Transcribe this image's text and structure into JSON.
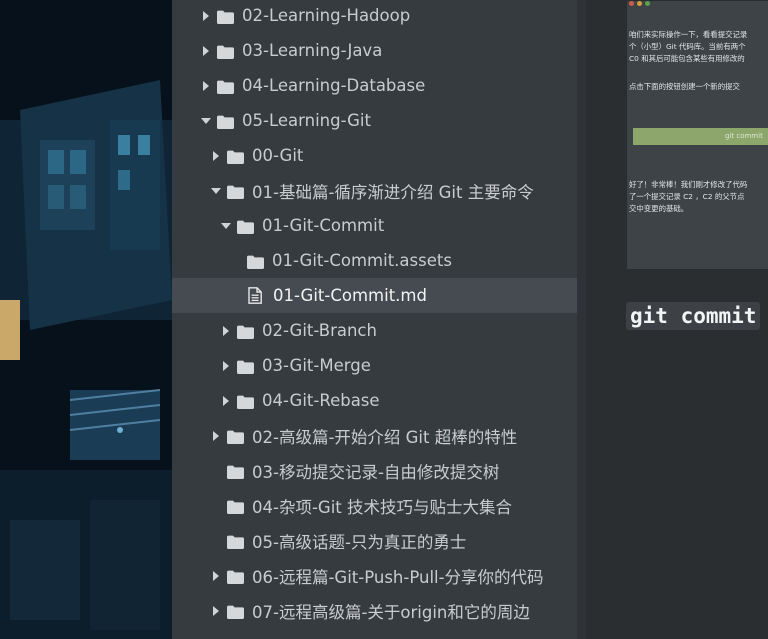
{
  "tree": [
    {
      "label": "02-Learning-Hadoop",
      "indent": 0,
      "type": "folder",
      "expanded": false
    },
    {
      "label": "03-Learning-Java",
      "indent": 0,
      "type": "folder",
      "expanded": false
    },
    {
      "label": "04-Learning-Database",
      "indent": 0,
      "type": "folder",
      "expanded": false
    },
    {
      "label": "05-Learning-Git",
      "indent": 0,
      "type": "folder",
      "expanded": true
    },
    {
      "label": "00-Git",
      "indent": 1,
      "type": "folder",
      "expanded": false
    },
    {
      "label": "01-基础篇-循序渐进介绍 Git 主要命令",
      "indent": 1,
      "type": "folder",
      "expanded": true
    },
    {
      "label": "01-Git-Commit",
      "indent": 2,
      "type": "folder",
      "expanded": true
    },
    {
      "label": "01-Git-Commit.assets",
      "indent": 3,
      "type": "folder",
      "expanded": null
    },
    {
      "label": "01-Git-Commit.md",
      "indent": 3,
      "type": "file",
      "selected": true
    },
    {
      "label": "02-Git-Branch",
      "indent": 2,
      "type": "folder",
      "expanded": false
    },
    {
      "label": "03-Git-Merge",
      "indent": 2,
      "type": "folder",
      "expanded": false
    },
    {
      "label": "04-Git-Rebase",
      "indent": 2,
      "type": "folder",
      "expanded": false
    },
    {
      "label": "02-高级篇-开始介绍 Git 超棒的特性",
      "indent": 1,
      "type": "folder",
      "expanded": false
    },
    {
      "label": "03-移动提交记录-自由修改提交树",
      "indent": 1,
      "type": "folder",
      "expanded": null
    },
    {
      "label": "04-杂项-Git 技术技巧与贴士大集合",
      "indent": 1,
      "type": "folder",
      "expanded": null
    },
    {
      "label": "05-高级话题-只为真正的勇士",
      "indent": 1,
      "type": "folder",
      "expanded": null
    },
    {
      "label": "06-远程篇-Git-Push-Pull-分享你的代码",
      "indent": 1,
      "type": "folder",
      "expanded": false
    },
    {
      "label": "07-远程高级篇-关于origin和它的周边",
      "indent": 1,
      "type": "folder",
      "expanded": false
    }
  ],
  "content": {
    "thumb_lines": [
      "咱们来实际操作一下，看看提交记录",
      "个（小型）Git 代码库。当前有两个",
      "C0  和其后可能包含某些有用修改的",
      "点击下面的按钮创建一个新的提交",
      "好了！非常棒！我们刚才修改了代码",
      "了一个提交记录  C2 ，C2 的父节点",
      "交中变更的基础。"
    ],
    "thumb_button": "git commit",
    "heading_code": "git commit"
  },
  "colors": {
    "sidebar_bg": "#363b40",
    "selected_bg": "#464b51",
    "content_bg": "#2b2e31",
    "text": "#c9ccce",
    "accent_green": "#8da66c"
  },
  "icons": {
    "folder": "folder-icon",
    "file": "file-icon",
    "expanded": "caret-down-icon",
    "collapsed": "caret-right-icon"
  }
}
